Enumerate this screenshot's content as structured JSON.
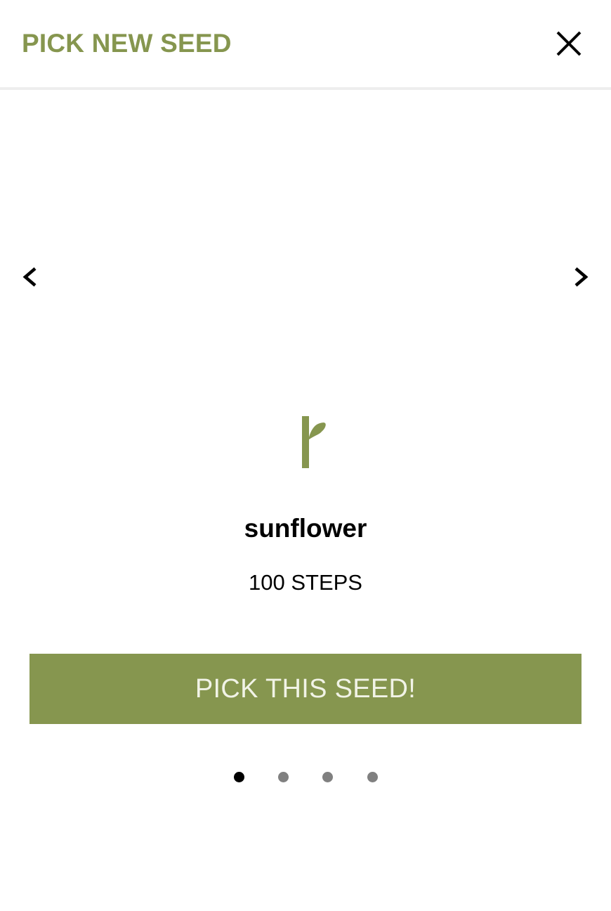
{
  "header": {
    "title": "PICK NEW SEED",
    "close_icon": "close-icon"
  },
  "carousel": {
    "prev_icon": "chevron-left-icon",
    "next_icon": "chevron-right-icon",
    "current_seed": {
      "icon": "sprout-icon",
      "name": "sunflower",
      "steps": "100 STEPS"
    },
    "pick_button_label": "PICK THIS SEED!",
    "page_count": 4,
    "active_page": 1
  },
  "colors": {
    "accent": "#86964f",
    "button_text": "#f1f3e6",
    "dot_inactive": "#808080",
    "dot_active": "#000000"
  }
}
